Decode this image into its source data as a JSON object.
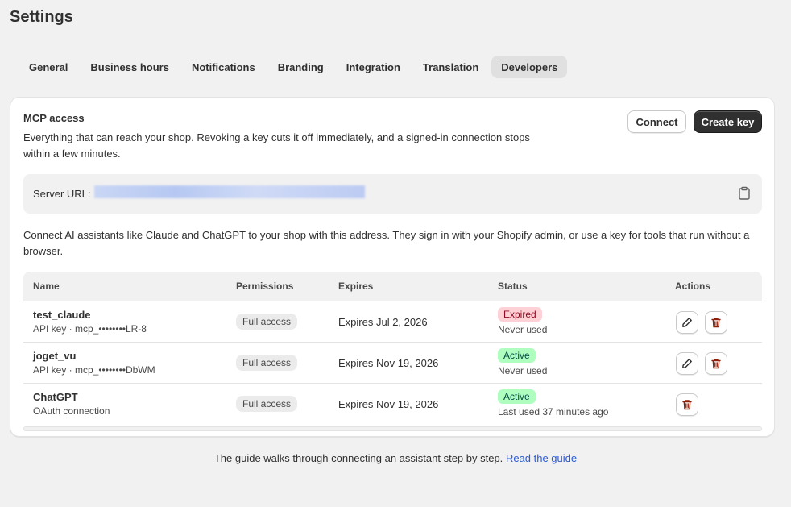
{
  "page": {
    "title": "Settings"
  },
  "tabs": [
    {
      "label": "General"
    },
    {
      "label": "Business hours"
    },
    {
      "label": "Notifications"
    },
    {
      "label": "Branding"
    },
    {
      "label": "Integration"
    },
    {
      "label": "Translation"
    },
    {
      "label": "Developers",
      "active": true
    }
  ],
  "mcp": {
    "title": "MCP access",
    "description": "Everything that can reach your shop. Revoking a key cuts it off immediately, and a signed-in connection stops within a few minutes.",
    "connect_label": "Connect",
    "create_key_label": "Create key",
    "server_url_label": "Server URL:",
    "server_url_icon": "clipboard-icon",
    "helper_text": "Connect AI assistants like Claude and ChatGPT to your shop with this address. They sign in with your Shopify admin, or use a key for tools that run without a browser."
  },
  "table": {
    "headers": {
      "name": "Name",
      "permissions": "Permissions",
      "expires": "Expires",
      "status": "Status",
      "actions": "Actions"
    },
    "rows": [
      {
        "name": "test_claude",
        "sub": "API key · mcp_••••••••LR-8",
        "permission": "Full access",
        "expires": "Expires Jul 2, 2026",
        "status": "Expired",
        "status_kind": "expired",
        "last_used": "Never used",
        "actions": [
          "edit",
          "delete"
        ]
      },
      {
        "name": "joget_vu",
        "sub": "API key · mcp_••••••••DbWM",
        "permission": "Full access",
        "expires": "Expires Nov 19, 2026",
        "status": "Active",
        "status_kind": "active",
        "last_used": "Never used",
        "actions": [
          "edit",
          "delete"
        ]
      },
      {
        "name": "ChatGPT",
        "sub": "OAuth connection",
        "permission": "Full access",
        "expires": "Expires Nov 19, 2026",
        "status": "Active",
        "status_kind": "active",
        "last_used": "Last used 37 minutes ago",
        "actions": [
          "delete"
        ]
      }
    ]
  },
  "footer": {
    "text": "The guide walks through connecting an assistant step by step.",
    "link_label": "Read the guide"
  },
  "colors": {
    "primary_button": "#303030",
    "expired_bg": "#fed1d7",
    "active_bg": "#affebf",
    "link": "#2a5bd7",
    "delete_icon": "#8e1f0b"
  }
}
